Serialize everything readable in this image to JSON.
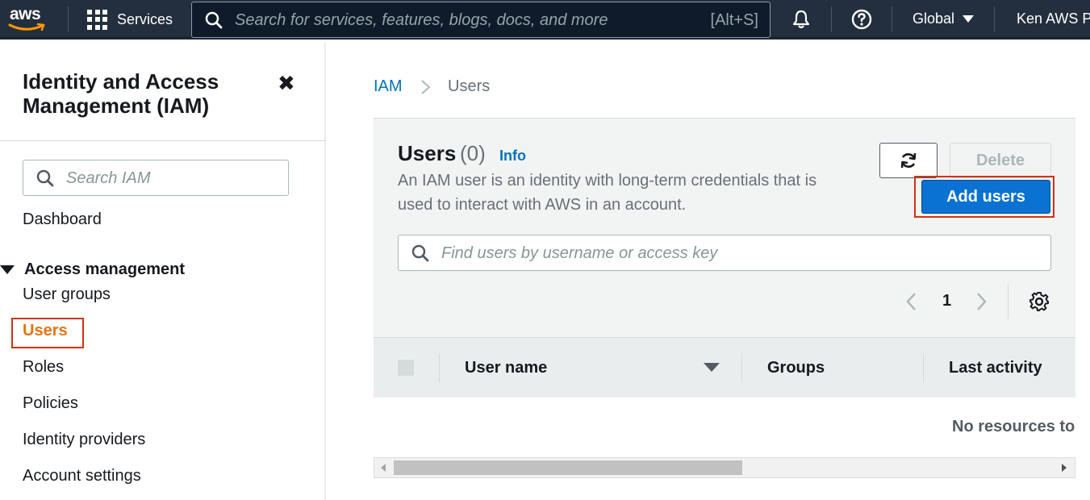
{
  "topnav": {
    "logo_text": "aws",
    "services_label": "Services",
    "search_placeholder": "Search for services, features, blogs, docs, and more",
    "search_shortcut": "[Alt+S]",
    "region_label": "Global",
    "account_label": "Ken AWS Pr",
    "icons": [
      "grid-icon",
      "search-icon",
      "bell-icon",
      "help-icon",
      "caret-down-icon"
    ]
  },
  "sidebar": {
    "title": "Identity and Access Management (IAM)",
    "close_icon": "close-icon",
    "search_placeholder": "Search IAM",
    "dashboard_label": "Dashboard",
    "section_label": "Access management",
    "items": [
      {
        "label": "User groups",
        "active": false
      },
      {
        "label": "Users",
        "active": true
      },
      {
        "label": "Roles",
        "active": false
      },
      {
        "label": "Policies",
        "active": false
      },
      {
        "label": "Identity providers",
        "active": false
      },
      {
        "label": "Account settings",
        "active": false
      }
    ]
  },
  "breadcrumb": {
    "root": "IAM",
    "current": "Users"
  },
  "users_panel": {
    "title": "Users",
    "count": "(0)",
    "info_link": "Info",
    "description": "An IAM user is an identity with long-term credentials that is used to interact with AWS in an account.",
    "delete_label": "Delete",
    "add_label": "Add users",
    "search_placeholder": "Find users by username or access key",
    "page_number": "1",
    "columns": [
      "User name",
      "Groups",
      "Last activity"
    ],
    "empty_message": "No resources to"
  },
  "colors": {
    "nav_bg": "#232f3e",
    "link": "#0073bb",
    "active_nav": "#ec7211",
    "primary_button": "#0972d3",
    "highlight_box": "#d13212"
  }
}
